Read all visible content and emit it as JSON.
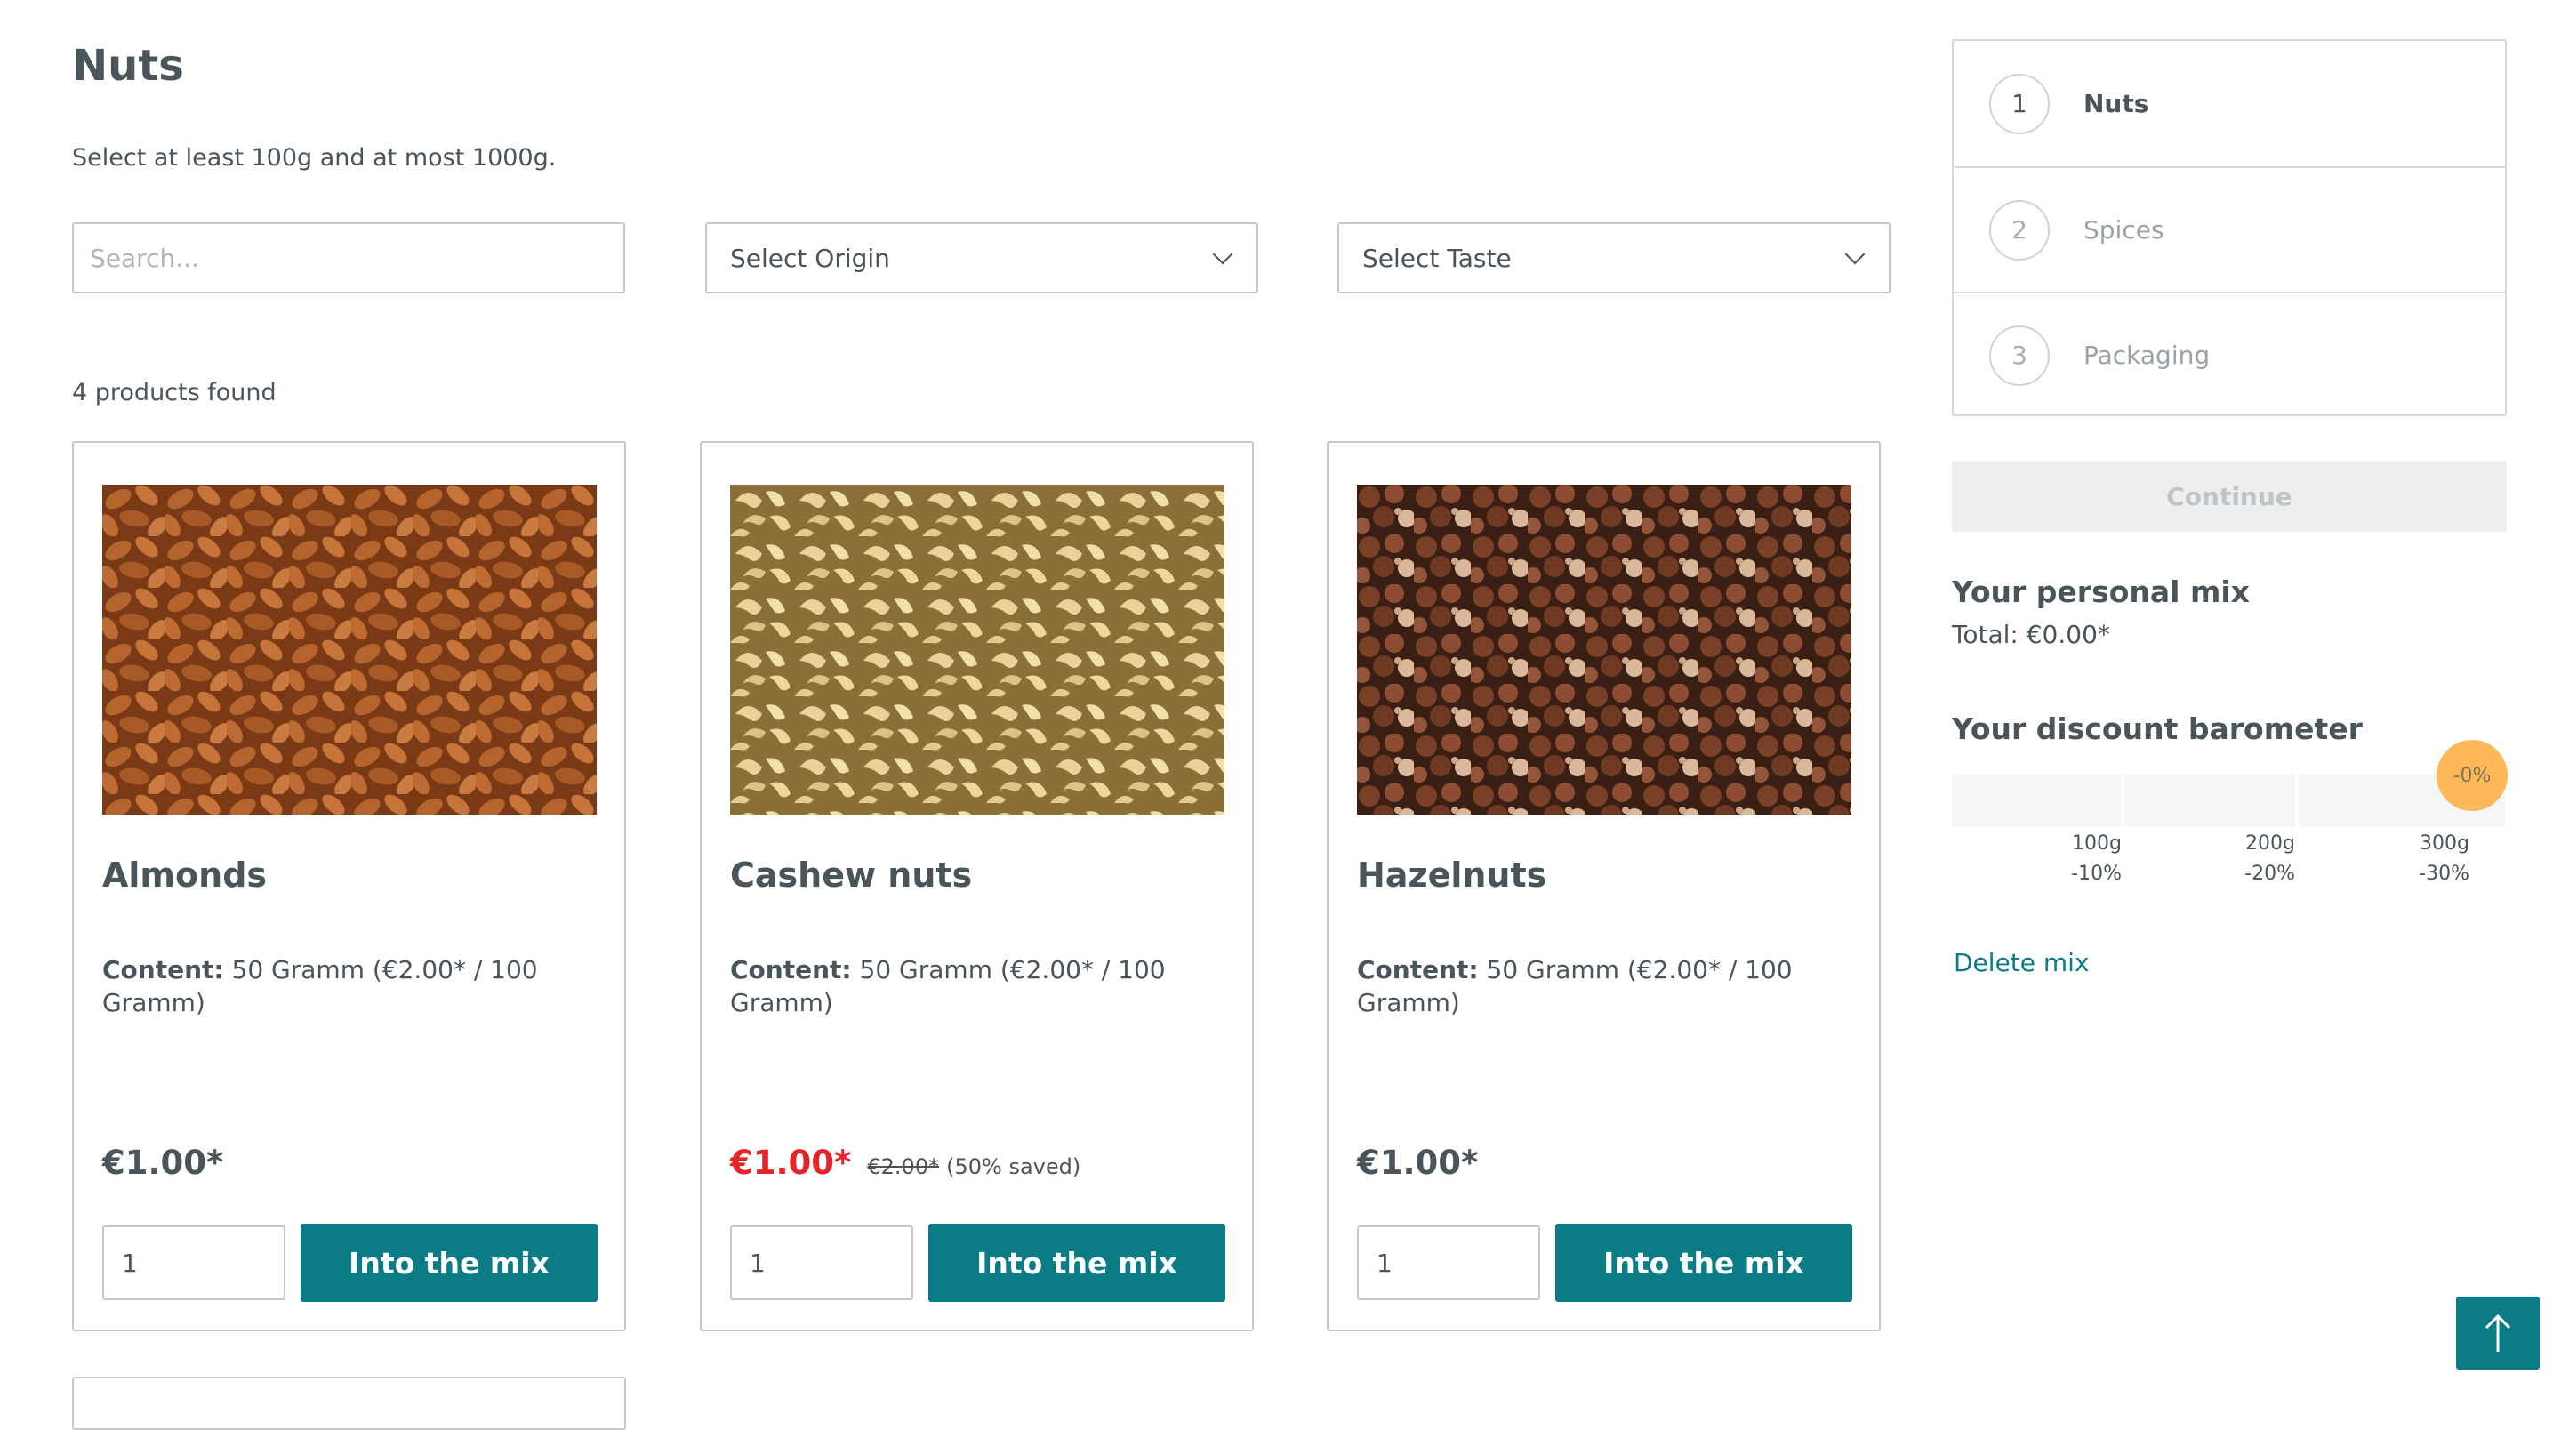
{
  "page": {
    "title": "Nuts",
    "subtitle": "Select at least 100g and at most 1000g."
  },
  "filters": {
    "search_placeholder": "Search...",
    "origin_label": "Select Origin",
    "taste_label": "Select Taste"
  },
  "results": {
    "count_text": "4 products found"
  },
  "products": [
    {
      "name": "Almonds",
      "content_label": "Content:",
      "content_text": "50 Gramm (€2.00* / 100 Gramm)",
      "price": "€1.00*",
      "old_price": "",
      "saved": "",
      "qty": "1",
      "button": "Into the mix",
      "image_icon": "almonds-image"
    },
    {
      "name": "Cashew nuts",
      "content_label": "Content:",
      "content_text": "50 Gramm (€2.00* / 100 Gramm)",
      "price": "€1.00*",
      "old_price": "€2.00*",
      "saved": "(50% saved)",
      "qty": "1",
      "button": "Into the mix",
      "image_icon": "cashews-image"
    },
    {
      "name": "Hazelnuts",
      "content_label": "Content:",
      "content_text": "50 Gramm (€2.00* / 100 Gramm)",
      "price": "€1.00*",
      "old_price": "",
      "saved": "",
      "qty": "1",
      "button": "Into the mix",
      "image_icon": "hazelnuts-image"
    }
  ],
  "sidebar": {
    "steps": [
      {
        "number": "1",
        "label": "Nuts"
      },
      {
        "number": "2",
        "label": "Spices"
      },
      {
        "number": "3",
        "label": "Packaging"
      }
    ],
    "continue_label": "Continue",
    "mix_title": "Your personal mix",
    "total": "Total: €0.00*",
    "barometer_title": "Your discount barometer",
    "barometer_badge": "-0%",
    "barometer_ticks": [
      {
        "weight": "100g",
        "discount": "-10%"
      },
      {
        "weight": "200g",
        "discount": "-20%"
      },
      {
        "weight": "300g",
        "discount": "-30%"
      }
    ],
    "delete_label": "Delete mix"
  },
  "colors": {
    "accent": "#0b7c86",
    "sale": "#e52427",
    "badge": "#fdb85a",
    "text": "#4a545b"
  },
  "icons": {
    "select_chevron": "chevron-down-icon",
    "back_to_top": "arrow-up-icon"
  }
}
